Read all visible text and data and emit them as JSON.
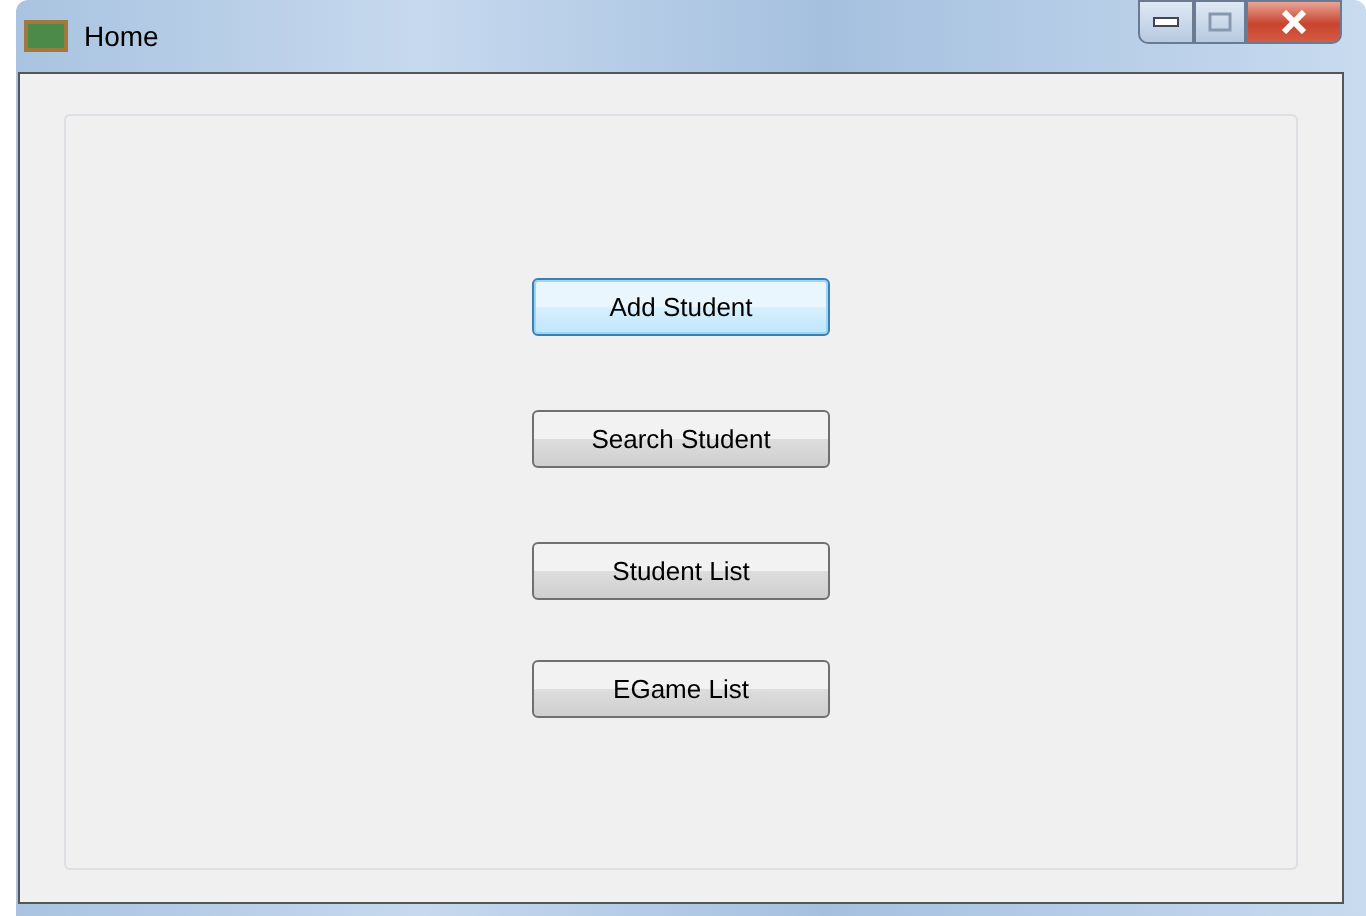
{
  "window": {
    "title": "Home"
  },
  "buttons": [
    {
      "label": "Add Student",
      "focused": true
    },
    {
      "label": "Search Student",
      "focused": false
    },
    {
      "label": "Student List",
      "focused": false
    },
    {
      "label": "EGame List",
      "focused": false
    }
  ]
}
